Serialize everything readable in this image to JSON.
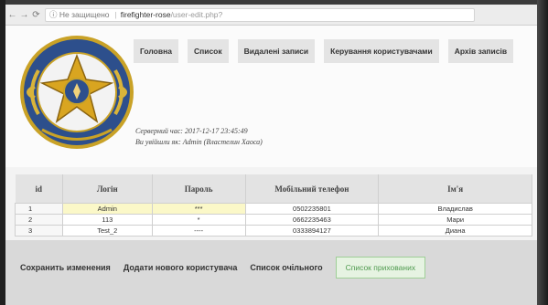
{
  "browser": {
    "security_label": "Не защищено",
    "url_host": "firefighter-rose",
    "url_path": "/user-edit.php?"
  },
  "menu": [
    {
      "label": "Головна"
    },
    {
      "label": "Список"
    },
    {
      "label": "Видалені записи"
    },
    {
      "label": "Керування користувачами"
    },
    {
      "label": "Архів записів"
    }
  ],
  "info": {
    "server_time": "Серверний час: 2017-12-17 23:45:49",
    "logged_as": "Ви увійшли як: Admin (Властелин Хаоса)"
  },
  "table": {
    "headers": [
      "id",
      "Логін",
      "Пароль",
      "Мобільний телефон",
      "Ім'я"
    ],
    "rows": [
      [
        "1",
        "Admin",
        "***",
        "0502235801",
        "Владислав"
      ],
      [
        "2",
        "113",
        "*",
        "0662235463",
        "Мари"
      ],
      [
        "3",
        "Test_2",
        "----",
        "0333894127",
        "Диана"
      ]
    ]
  },
  "actions": {
    "save": "Сохранить изменения",
    "add_user": "Додати нового користувача",
    "delete_all": "Список очільного",
    "hidden_list": "Список прихованих"
  },
  "colors": {
    "highlight_cell": "#fbf8c8",
    "green_button": "#4f9a4f"
  }
}
